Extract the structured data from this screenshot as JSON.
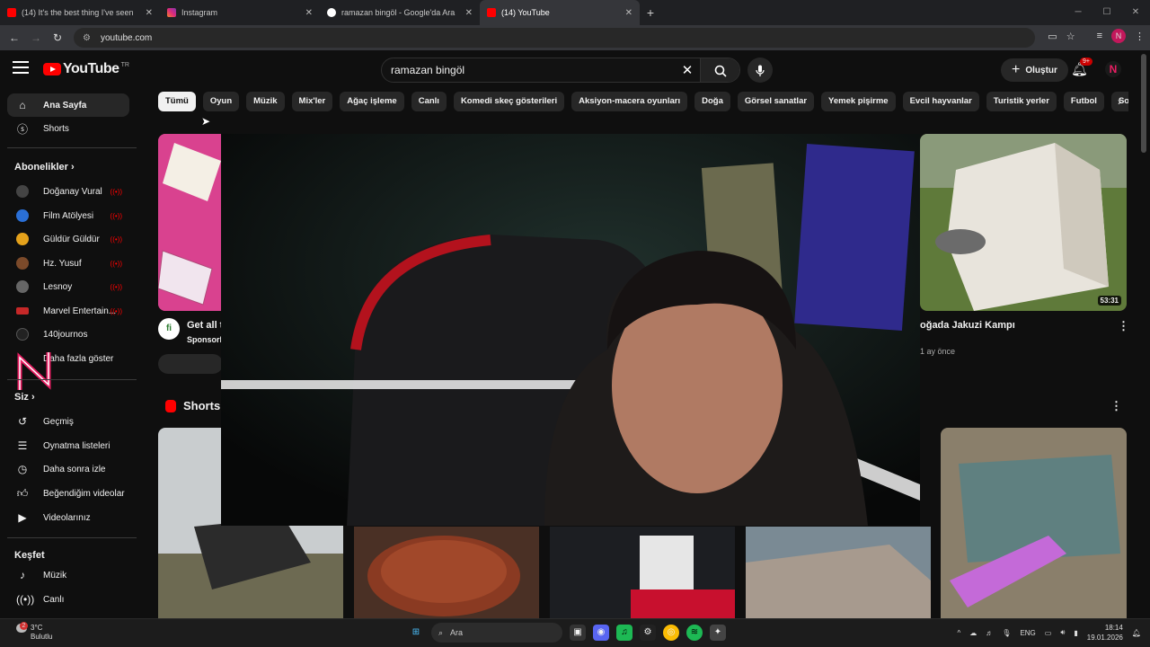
{
  "browser": {
    "tabs": [
      {
        "label": "(14) It's the best thing I've seen",
        "color": "#ff0000"
      },
      {
        "label": "Instagram",
        "color": "#e1306c"
      },
      {
        "label": "ramazan bingöl - Google'da Ara",
        "color": "#4285f4"
      },
      {
        "label": "(14) YouTube",
        "color": "#ff0000"
      }
    ],
    "url": "youtube.com",
    "new_tab": "+"
  },
  "header": {
    "logo_text": "YouTube",
    "country_code": "TR",
    "search_value": "ramazan bingöl",
    "create_label": "Oluştur",
    "notification_badge": "9+",
    "avatar_letter": "N"
  },
  "sidebar": {
    "main": [
      {
        "label": "Ana Sayfa",
        "icon": "home-icon"
      },
      {
        "label": "Shorts",
        "icon": "shorts-icon"
      }
    ],
    "subscriptions_heading": "Abonelikler",
    "subscriptions": [
      {
        "label": "Doğanay Vural",
        "color": "#444"
      },
      {
        "label": "Film Atölyesi",
        "color": "#2a6fd6"
      },
      {
        "label": "Güldür Güldür",
        "color": "#e4a11b"
      },
      {
        "label": "Hz. Yusuf",
        "color": "#7b4a2a"
      },
      {
        "label": "Lesnoy",
        "color": "#666"
      },
      {
        "label": "Marvel Entertain...",
        "color": "#c62828"
      },
      {
        "label": "140journos",
        "color": "#222"
      }
    ],
    "show_more": "Daha fazla göster",
    "you_heading": "Siz",
    "you_items": [
      {
        "label": "Geçmiş",
        "icon": "history-icon"
      },
      {
        "label": "Oynatma listeleri",
        "icon": "playlist-icon"
      },
      {
        "label": "Daha sonra izle",
        "icon": "watch-later-icon"
      },
      {
        "label": "Beğendiğim videolar",
        "icon": "like-icon"
      },
      {
        "label": "Videolarınız",
        "icon": "your-videos-icon"
      }
    ],
    "explore_heading": "Keşfet",
    "explore_items": [
      {
        "label": "Müzik",
        "icon": "music-icon"
      },
      {
        "label": "Canlı",
        "icon": "live-icon"
      }
    ]
  },
  "chips": [
    "Tümü",
    "Oyun",
    "Müzik",
    "Mix'ler",
    "Ağaç işleme",
    "Canlı",
    "Komedi skeç gösterileri",
    "Aksiyon-macera oyunları",
    "Doğa",
    "Görsel sanatlar",
    "Yemek pişirme",
    "Evcil hayvanlar",
    "Turistik yerler",
    "Futbol",
    "Son yüklenen"
  ],
  "videos": {
    "ad": {
      "title": "Get all t",
      "channel": "Sponsorl",
      "logo": "fi"
    },
    "right": {
      "title": "oğada Jakuzi Kampı",
      "meta": "1 ay önce",
      "duration": "53:31"
    }
  },
  "shorts_heading": "Shorts",
  "taskbar": {
    "temperature": "3°C",
    "weather": "Bulutlu",
    "search_label": "Ara",
    "language": "ENG",
    "time": "18:14",
    "date": "19.01.2026",
    "weather_badge": "2"
  }
}
